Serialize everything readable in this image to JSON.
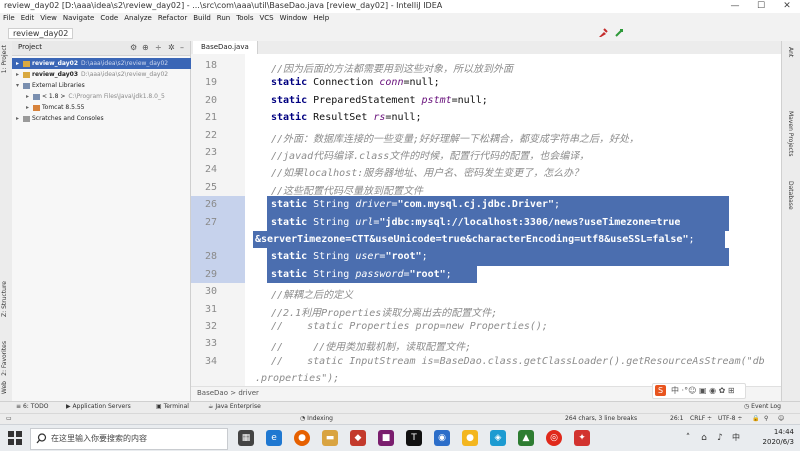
{
  "window": {
    "title": "review_day02 [D:\\aaa\\idea\\s2\\review_day02] - ...\\src\\com\\aaa\\util\\BaseDao.java [review_day02] - IntelliJ IDEA",
    "controls": {
      "minimize": "—",
      "maximize": "☐",
      "close": "✕"
    }
  },
  "menu": [
    "File",
    "Edit",
    "View",
    "Navigate",
    "Code",
    "Analyze",
    "Refactor",
    "Build",
    "Run",
    "Tools",
    "VCS",
    "Window",
    "Help"
  ],
  "navbar": {
    "crumb": "review_day02"
  },
  "left_strip": [
    "1: Project",
    "Z: Structure",
    "2: Favorites",
    "Web"
  ],
  "project": {
    "title": "Project",
    "tree": [
      {
        "label": "review_day02",
        "hint": "D:\\aaa\\idea\\s2\\review_day02",
        "selected": true,
        "arrow": "▸"
      },
      {
        "label": "review_day03",
        "hint": "D:\\aaa\\idea\\s2\\review_day02",
        "selected": false,
        "arrow": "▸"
      },
      {
        "label": "External Libraries",
        "hint": "",
        "selected": false,
        "arrow": "▾"
      },
      {
        "label": "< 1.8 >",
        "hint": "C:\\Program Files\\Java\\jdk1.8.0_5",
        "selected": false,
        "arrow": "▸"
      },
      {
        "label": "Tomcat 8.5.55",
        "hint": "",
        "selected": false,
        "arrow": "▸"
      },
      {
        "label": "Scratches and Consoles",
        "hint": "",
        "selected": false,
        "arrow": "▸"
      }
    ]
  },
  "editor": {
    "tab": "BaseDao.java",
    "lines": [
      {
        "n": "18",
        "segs": [
          {
            "c": "cm",
            "t": "//因为后面的方法都需要用到这些对象，所以放到外面"
          }
        ]
      },
      {
        "n": "19",
        "segs": [
          {
            "c": "kw",
            "t": "static "
          },
          {
            "c": "",
            "t": "Connection "
          },
          {
            "c": "var",
            "t": "conn"
          },
          {
            "c": "",
            "t": "=null;"
          }
        ]
      },
      {
        "n": "20",
        "segs": [
          {
            "c": "kw",
            "t": "static "
          },
          {
            "c": "",
            "t": "PreparedStatement "
          },
          {
            "c": "var",
            "t": "pstmt"
          },
          {
            "c": "",
            "t": "=null;"
          }
        ]
      },
      {
        "n": "21",
        "segs": [
          {
            "c": "kw",
            "t": "static "
          },
          {
            "c": "",
            "t": "ResultSet "
          },
          {
            "c": "var",
            "t": "rs"
          },
          {
            "c": "",
            "t": "=null;"
          }
        ]
      },
      {
        "n": "22",
        "segs": [
          {
            "c": "cm",
            "t": "//外面：数据库连接的一些变量;好好理解一下松耦合，都变成字符串之后，好处，"
          }
        ]
      },
      {
        "n": "23",
        "segs": [
          {
            "c": "cm",
            "t": "//javad代码编译.class文件的时候，配置行代码的配置，也会编译，"
          }
        ]
      },
      {
        "n": "24",
        "segs": [
          {
            "c": "cm",
            "t": "//如果localhost:服务器地址、用户名、密码发生变更了，怎么办？"
          }
        ]
      },
      {
        "n": "25",
        "segs": [
          {
            "c": "cm",
            "t": "//这些配置代码尽量放到配置文件"
          }
        ]
      },
      {
        "n": "26",
        "segs": [
          {
            "c": "kw",
            "t": "static "
          },
          {
            "c": "",
            "t": "String "
          },
          {
            "c": "var",
            "t": "driver"
          },
          {
            "c": "",
            "t": "="
          },
          {
            "c": "str",
            "t": "\"com.mysql.cj.jdbc.Driver\""
          },
          {
            "c": "",
            "t": ";"
          }
        ]
      },
      {
        "n": "27",
        "segs": [
          {
            "c": "kw",
            "t": "static "
          },
          {
            "c": "",
            "t": "String "
          },
          {
            "c": "var",
            "t": "url"
          },
          {
            "c": "",
            "t": "="
          },
          {
            "c": "str",
            "t": "\"jdbc:mysql://localhost:3306/news?useTimezone=true"
          }
        ]
      },
      {
        "n": "",
        "segs": [
          {
            "c": "str",
            "t": "&serverTimezone=CTT&useUnicode=true&characterEncoding=utf8&useSSL=false\""
          },
          {
            "c": "",
            "t": ";"
          }
        ]
      },
      {
        "n": "28",
        "segs": [
          {
            "c": "kw",
            "t": "static "
          },
          {
            "c": "",
            "t": "String "
          },
          {
            "c": "var",
            "t": "user"
          },
          {
            "c": "",
            "t": "="
          },
          {
            "c": "str",
            "t": "\"root\""
          },
          {
            "c": "",
            "t": ";"
          }
        ]
      },
      {
        "n": "29",
        "segs": [
          {
            "c": "kw",
            "t": "static "
          },
          {
            "c": "",
            "t": "String "
          },
          {
            "c": "var",
            "t": "password"
          },
          {
            "c": "",
            "t": "="
          },
          {
            "c": "str",
            "t": "\"root\""
          },
          {
            "c": "",
            "t": ";"
          }
        ]
      },
      {
        "n": "30",
        "segs": [
          {
            "c": "cm",
            "t": "//解耦之后的定义"
          }
        ]
      },
      {
        "n": "31",
        "segs": [
          {
            "c": "cm",
            "t": "//2.1利用Properties读取分离出去的配置文件;"
          }
        ]
      },
      {
        "n": "32",
        "segs": [
          {
            "c": "cm",
            "t": "//    static Properties prop=new Properties();"
          }
        ]
      },
      {
        "n": "33",
        "segs": [
          {
            "c": "cm",
            "t": "//     //使用类加载机制，读取配置文件;"
          }
        ]
      },
      {
        "n": "34",
        "segs": [
          {
            "c": "cm",
            "t": "//    static InputStream is=BaseDao.class.getClassLoader().getResourceAsStream(\"db"
          }
        ]
      },
      {
        "n": "",
        "segs": [
          {
            "c": "cm",
            "t": ".properties\");"
          }
        ]
      }
    ],
    "selection_lines": [
      8,
      9,
      10,
      11,
      12
    ]
  },
  "right_strip": [
    "Ant",
    "Maven Projects",
    "Database"
  ],
  "crumbbar": {
    "text": "BaseDao  >  driver"
  },
  "tool_windows": [
    {
      "icon": "≡",
      "label": "6: TODO"
    },
    {
      "icon": "▶",
      "label": "Application Servers"
    },
    {
      "icon": "▣",
      "label": "Terminal"
    },
    {
      "icon": "☕",
      "label": "Java Enterprise"
    },
    {
      "icon": "◷",
      "label": "Event Log"
    }
  ],
  "status": {
    "left": "Indexing",
    "chars": "264 chars, 3 line breaks",
    "pos": "26:1",
    "crlf": "CRLF ÷",
    "enc": "UTF-8 ÷"
  },
  "taskbar": {
    "search_placeholder": "在这里输入你要搜索的内容",
    "time": "14:44",
    "date": "2020/6/3",
    "ime": "S"
  },
  "colors": {
    "selection": "#4b6eaf",
    "project_selected": "#3a66b6",
    "keyword": "#000080",
    "string": "#067d17",
    "comment": "#8c8c8c"
  }
}
